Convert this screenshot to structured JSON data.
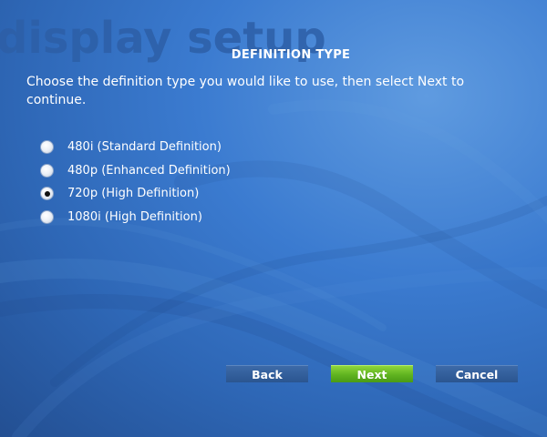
{
  "watermark": "display setup",
  "title": "DEFINITION TYPE",
  "instructions": "Choose the definition type you would like to use, then select Next to continue.",
  "options": [
    {
      "label": "480i (Standard Definition)",
      "selected": false
    },
    {
      "label": "480p (Enhanced Definition)",
      "selected": false
    },
    {
      "label": "720p (High Definition)",
      "selected": true
    },
    {
      "label": "1080i (High Definition)",
      "selected": false
    }
  ],
  "buttons": {
    "back": "Back",
    "next": "Next",
    "cancel": "Cancel"
  },
  "colors": {
    "background": "#3b7bd0",
    "accent_green": "#5fb320",
    "button_dark": "#2b5590"
  }
}
